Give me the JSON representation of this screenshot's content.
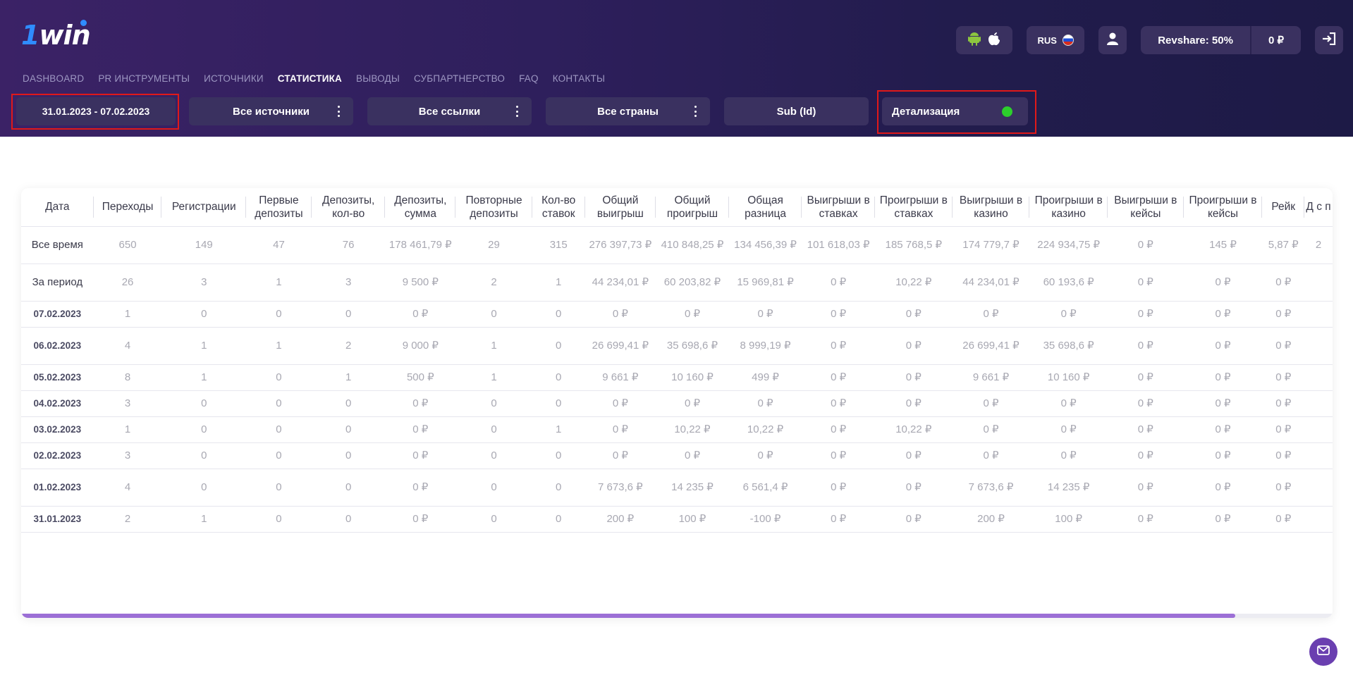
{
  "brand": {
    "logo_part1": "1",
    "logo_part2": "win"
  },
  "topbar": {
    "lang": "RUS",
    "revshare": "Revshare: 50%",
    "balance": "0 ₽"
  },
  "nav": [
    {
      "label": "DASHBOARD",
      "active": false
    },
    {
      "label": "PR ИНСТРУМЕНТЫ",
      "active": false
    },
    {
      "label": "ИСТОЧНИКИ",
      "active": false
    },
    {
      "label": "СТАТИСТИКА",
      "active": true
    },
    {
      "label": "ВЫВОДЫ",
      "active": false
    },
    {
      "label": "СУБПАРТНЕРСТВО",
      "active": false
    },
    {
      "label": "FAQ",
      "active": false
    },
    {
      "label": "КОНТАКТЫ",
      "active": false
    }
  ],
  "filters": {
    "date_range": "31.01.2023 - 07.02.2023",
    "sources": "Все источники",
    "links": "Все ссылки",
    "countries": "Все страны",
    "subid": "Sub (Id)",
    "detail": "Детализация"
  },
  "colors": {
    "accent": "#9c6fd6",
    "header_bg": "#2e1f5c",
    "toggle_on": "#2ccf2c",
    "highlight_box": "#e01919"
  },
  "table": {
    "headers": [
      "Дата",
      "Переходы",
      "Регистрации",
      "Первые депозиты",
      "Депозиты, кол-во",
      "Депозиты, сумма",
      "Повторные депозиты",
      "Кол-во ставок",
      "Общий выигрыш",
      "Общий проигрыш",
      "Общая разница",
      "Выигрыши в ставках",
      "Проигрыши в ставках",
      "Выигрыши в казино",
      "Проигрыши в казино",
      "Выигрыши в кейсы",
      "Проигрыши в кейсы",
      "Рейк",
      "Д с п"
    ],
    "rows": [
      [
        "Все время",
        "650",
        "149",
        "47",
        "76",
        "178 461,79 ₽",
        "29",
        "315",
        "276 397,73 ₽",
        "410 848,25 ₽",
        "134 456,39 ₽",
        "101 618,03 ₽",
        "185 768,5 ₽",
        "174 779,7 ₽",
        "224 934,75 ₽",
        "0 ₽",
        "145 ₽",
        "5,87 ₽",
        "2"
      ],
      [
        "За период",
        "26",
        "3",
        "1",
        "3",
        "9 500 ₽",
        "2",
        "1",
        "44 234,01 ₽",
        "60 203,82 ₽",
        "15 969,81 ₽",
        "0 ₽",
        "10,22 ₽",
        "44 234,01 ₽",
        "60 193,6 ₽",
        "0 ₽",
        "0 ₽",
        "0 ₽",
        ""
      ],
      [
        "07.02.2023",
        "1",
        "0",
        "0",
        "0",
        "0 ₽",
        "0",
        "0",
        "0 ₽",
        "0 ₽",
        "0 ₽",
        "0 ₽",
        "0 ₽",
        "0 ₽",
        "0 ₽",
        "0 ₽",
        "0 ₽",
        "0 ₽",
        ""
      ],
      [
        "06.02.2023",
        "4",
        "1",
        "1",
        "2",
        "9 000 ₽",
        "1",
        "0",
        "26 699,41 ₽",
        "35 698,6 ₽",
        "8 999,19 ₽",
        "0 ₽",
        "0 ₽",
        "26 699,41 ₽",
        "35 698,6 ₽",
        "0 ₽",
        "0 ₽",
        "0 ₽",
        ""
      ],
      [
        "05.02.2023",
        "8",
        "1",
        "0",
        "1",
        "500 ₽",
        "1",
        "0",
        "9 661 ₽",
        "10 160 ₽",
        "499 ₽",
        "0 ₽",
        "0 ₽",
        "9 661 ₽",
        "10 160 ₽",
        "0 ₽",
        "0 ₽",
        "0 ₽",
        ""
      ],
      [
        "04.02.2023",
        "3",
        "0",
        "0",
        "0",
        "0 ₽",
        "0",
        "0",
        "0 ₽",
        "0 ₽",
        "0 ₽",
        "0 ₽",
        "0 ₽",
        "0 ₽",
        "0 ₽",
        "0 ₽",
        "0 ₽",
        "0 ₽",
        ""
      ],
      [
        "03.02.2023",
        "1",
        "0",
        "0",
        "0",
        "0 ₽",
        "0",
        "1",
        "0 ₽",
        "10,22 ₽",
        "10,22 ₽",
        "0 ₽",
        "10,22 ₽",
        "0 ₽",
        "0 ₽",
        "0 ₽",
        "0 ₽",
        "0 ₽",
        ""
      ],
      [
        "02.02.2023",
        "3",
        "0",
        "0",
        "0",
        "0 ₽",
        "0",
        "0",
        "0 ₽",
        "0 ₽",
        "0 ₽",
        "0 ₽",
        "0 ₽",
        "0 ₽",
        "0 ₽",
        "0 ₽",
        "0 ₽",
        "0 ₽",
        ""
      ],
      [
        "01.02.2023",
        "4",
        "0",
        "0",
        "0",
        "0 ₽",
        "0",
        "0",
        "7 673,6 ₽",
        "14 235 ₽",
        "6 561,4 ₽",
        "0 ₽",
        "0 ₽",
        "7 673,6 ₽",
        "14 235 ₽",
        "0 ₽",
        "0 ₽",
        "0 ₽",
        ""
      ],
      [
        "31.01.2023",
        "2",
        "1",
        "0",
        "0",
        "0 ₽",
        "0",
        "0",
        "200 ₽",
        "100 ₽",
        "-100 ₽",
        "0 ₽",
        "0 ₽",
        "200 ₽",
        "100 ₽",
        "0 ₽",
        "0 ₽",
        "0 ₽",
        ""
      ]
    ]
  },
  "icons": [
    "android-icon",
    "apple-icon",
    "flag-ru-icon",
    "user-icon",
    "logout-icon",
    "more-dots-icon",
    "mail-icon"
  ]
}
